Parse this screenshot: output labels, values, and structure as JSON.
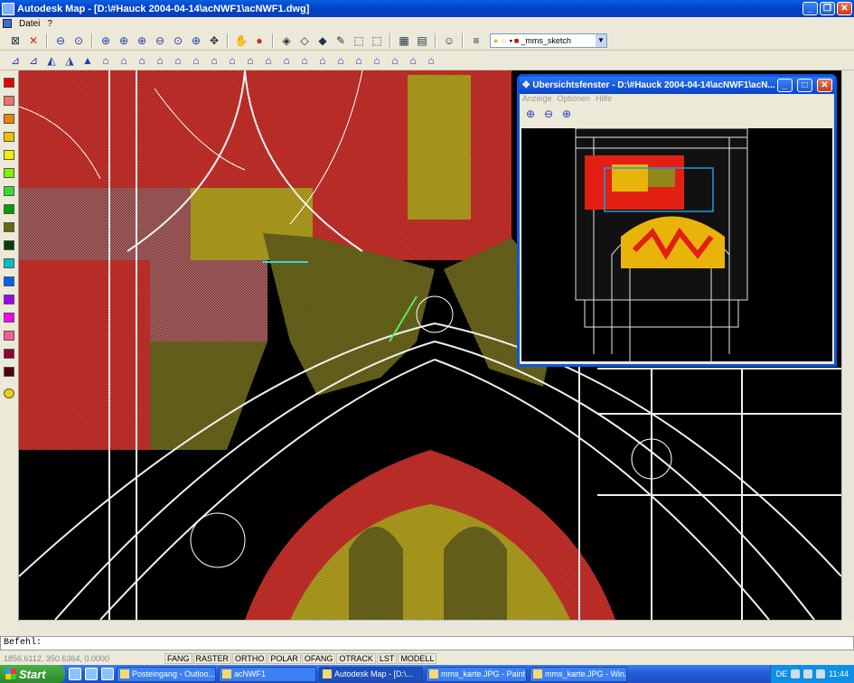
{
  "window": {
    "title": "Autodesk Map - [D:\\#Hauck 2004-04-14\\acNWF1\\acNWF1.dwg]",
    "minimize": "_",
    "restore": "❐",
    "close": "✕"
  },
  "menu": {
    "items": [
      "Datei",
      "?"
    ]
  },
  "layer": {
    "name": "_mms_sketch"
  },
  "drawing": {
    "colors": {
      "red": "#c8261e",
      "olive": "#6f6a1c",
      "yellow": "#d6c024",
      "white": "#f2f2f2"
    }
  },
  "overview": {
    "title": "Übersichtsfenster - D:\\#Hauck 2004-04-14\\acNWF1\\acN...",
    "menu": [
      "Anzeige",
      "Optionen",
      "Hilfe"
    ]
  },
  "command": {
    "prompt": "Befehl:"
  },
  "status": {
    "coords": "1856.6112, 350.6364, 0.0000",
    "buttons": [
      "FANG",
      "RASTER",
      "ORTHO",
      "POLAR",
      "OFANG",
      "OTRACK",
      "LST",
      "MODELL"
    ]
  },
  "taskbar": {
    "start": "Start",
    "tasks": [
      "Posteingang - Outloo...",
      "acNWF1",
      "Autodesk Map - [D:\\...",
      "mms_karte.JPG - Paint",
      "mms_karte.JPG - Win..."
    ],
    "lang": "DE",
    "clock": "11:44"
  }
}
